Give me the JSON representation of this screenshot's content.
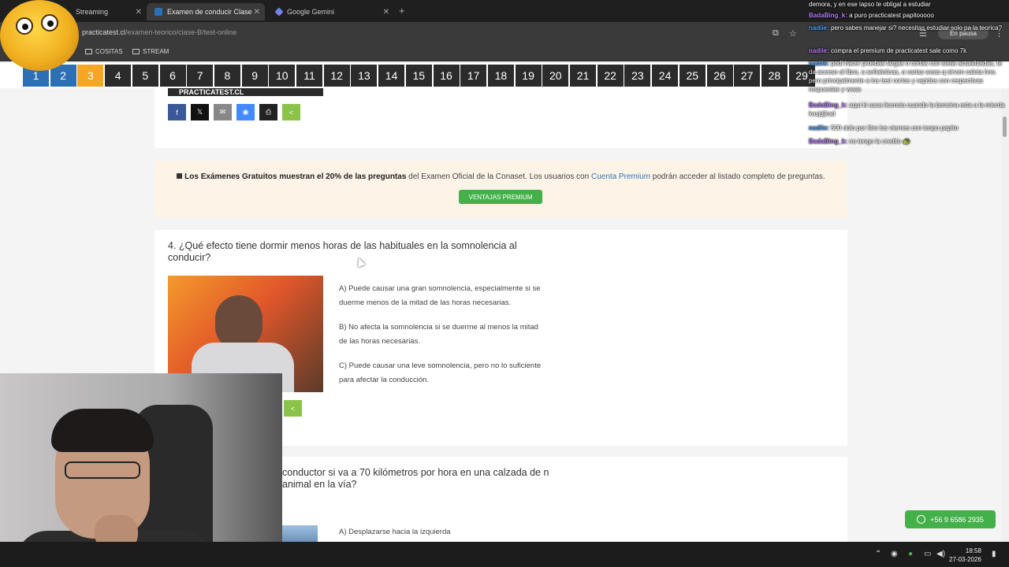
{
  "browser": {
    "tabs": [
      {
        "label": "Streaming"
      },
      {
        "label": "Examen de conducir Clase B - C"
      },
      {
        "label": "Google Gemini"
      }
    ],
    "url_domain": "practicatest.cl",
    "url_path": "/examen-teorico/clase-B/test-online",
    "bookmarks": [
      {
        "label": "COSITAS"
      },
      {
        "label": "STREAM"
      }
    ],
    "pause_label": "En pausa"
  },
  "question_nav": {
    "numbers": [
      "1",
      "2",
      "3",
      "4",
      "5",
      "6",
      "7",
      "8",
      "9",
      "10",
      "11",
      "12",
      "13",
      "14",
      "15",
      "16",
      "17",
      "18",
      "19",
      "20",
      "21",
      "22",
      "23",
      "24",
      "25",
      "26",
      "27",
      "28",
      "29"
    ],
    "current": "3"
  },
  "logo_text": "PRACTICATEST.CL",
  "notice": {
    "bold_text": "Los Exámenes Gratuitos muestran el 20% de las preguntas",
    "text_1": " del Examen Oficial de la Conaset. Los usuarios con ",
    "link_text": "Cuenta Premium",
    "text_2": " podrán acceder al listado completo de preguntas.",
    "button_label": "VENTAJAS PREMIUM"
  },
  "question4": {
    "title": "4. ¿Qué efecto tiene dormir menos horas de las habituales en la somnolencia al conducir?",
    "answers": [
      "A) Puede causar una gran somnolencia, especialmente si se duerme menos de la mitad de las horas necesarias.",
      "B) No afecta la somnolencia si se duerme al menos la mitad de las horas necesarias.",
      "C) Puede causar una leve somnolencia, pero no lo suficiente para afectar la conducción."
    ]
  },
  "question5": {
    "title": "conductor si va a 70 kilómetros por hora en una calzada de n animal en la vía?",
    "answer_a": "A) Desplazarse hacia la izquierda"
  },
  "whatsapp": {
    "label": "+56 9 6586 2935"
  },
  "chat": [
    {
      "user": "",
      "text": "demora, y en ese lapso te obligal a estudiar"
    },
    {
      "user": "BadaBing_k:",
      "text": "a puro practicatest papitooooo"
    },
    {
      "user": "nadiie:",
      "text": "pero sabes manejar si? necesitas estudiar solo pa la teorica?"
    },
    {
      "user": "nadiie:",
      "text": "compra el premium de practicatest sale como 7k"
    },
    {
      "user": "nadiie:",
      "text": "podi hacer pruebas largas o cortas con weas actualizadas, te da acceso al libro, a señaleticas, a varias weas q sirven caleta hno. pero principalmente a los test cortos y rapidos con respectivas respuestas y weas"
    },
    {
      "user": "BadaBing_k:",
      "text": "aqui ki saca licencia cuando la bencina esta a la mierda kasjdjkad"
    },
    {
      "user": "nadiie:",
      "text": "500 dolo por litro los viernes con tenpo papito"
    },
    {
      "user": "BadaBing_k:",
      "text": "no tengo la credito 🐢"
    }
  ],
  "taskbar": {
    "time": "18:58",
    "date": "27-03-2026"
  },
  "colors": {
    "nav_current": "#f5a623",
    "nav_done": "#2c6fb5",
    "premium_green": "#43b049",
    "link_blue": "#2a7ac0"
  }
}
